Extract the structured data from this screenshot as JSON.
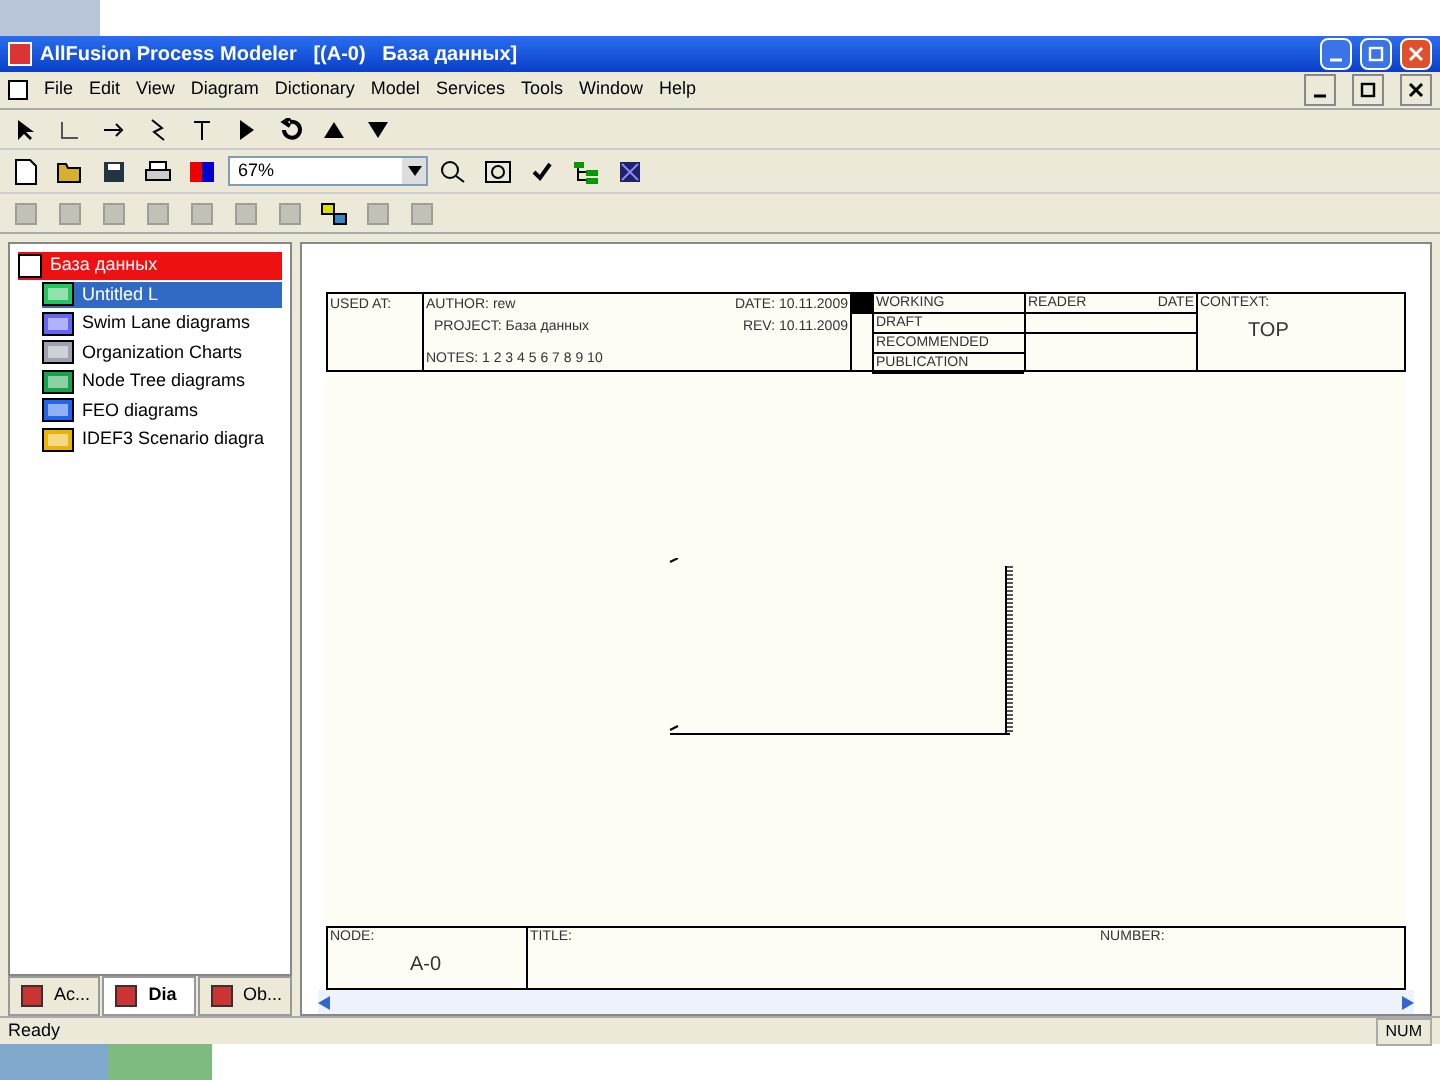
{
  "window": {
    "title": "AllFusion Process Modeler   [(A-0)   База данных]"
  },
  "menu": [
    "File",
    "Edit",
    "View",
    "Diagram",
    "Dictionary",
    "Model",
    "Services",
    "Tools",
    "Window",
    "Help"
  ],
  "zoom": {
    "value": "67%"
  },
  "tree": {
    "label": "База данных",
    "selected": false,
    "children": [
      {
        "label": "Untitled L",
        "selected": true
      },
      {
        "label": "Swim Lane diagrams",
        "selected": false
      },
      {
        "label": "Organization Charts",
        "selected": false
      },
      {
        "label": "Node Tree diagrams",
        "selected": false
      },
      {
        "label": "FEO diagrams",
        "selected": false
      },
      {
        "label": "IDEF3 Scenario diagra",
        "selected": false
      }
    ]
  },
  "panel_tabs": [
    {
      "label": "Ac...",
      "selected": false
    },
    {
      "label": "Dia",
      "selected": true
    },
    {
      "label": "Ob...",
      "selected": false
    }
  ],
  "frame": {
    "used_at": "USED AT:",
    "author": "AUTHOR: rew",
    "project": "PROJECT: База данных",
    "date": "DATE: 10.11.2009",
    "rev": "REV: 10.11.2009",
    "notes": "NOTES: 1 2 3 4 5 6 7 8 9 10",
    "statuses": [
      "WORKING",
      "DRAFT",
      "RECOMMENDED",
      "PUBLICATION"
    ],
    "reader": "READER",
    "reader_date": "DATE",
    "context": "CONTEXT:",
    "context_value": "TOP",
    "node": "NODE:",
    "node_value": "A-0",
    "title": "TITLE:",
    "number": "NUMBER:"
  },
  "status_bar": {
    "text": "Ready",
    "num": "NUM"
  }
}
